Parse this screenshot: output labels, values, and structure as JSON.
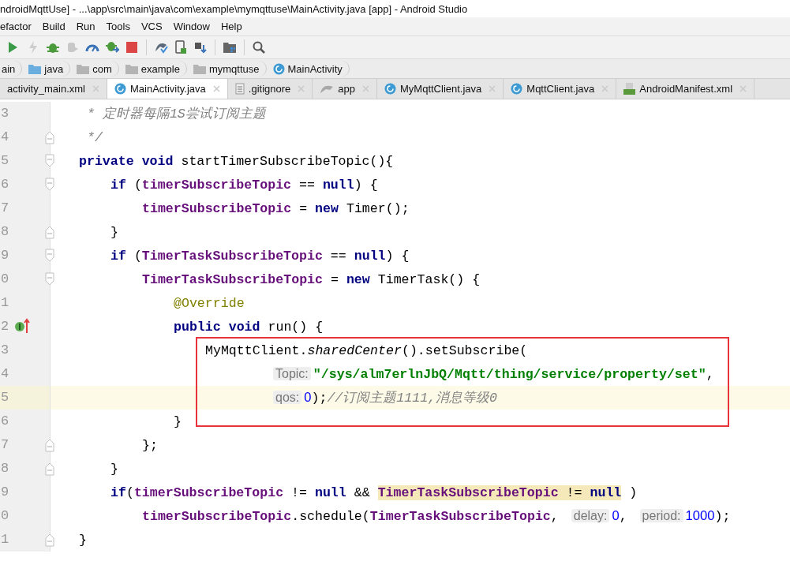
{
  "window": {
    "title": "ndroidMqttUse] - ...\\app\\src\\main\\java\\com\\example\\mymqttuse\\MainActivity.java [app] - Android Studio"
  },
  "menu": [
    "efactor",
    "Build",
    "Run",
    "Tools",
    "VCS",
    "Window",
    "Help"
  ],
  "toolbar": [
    {
      "kind": "run",
      "disabled": false
    },
    {
      "kind": "lightning",
      "disabled": true
    },
    {
      "kind": "debug",
      "disabled": false
    },
    {
      "kind": "attach",
      "disabled": true
    },
    {
      "kind": "profile",
      "disabled": false
    },
    {
      "kind": "apply",
      "disabled": false
    },
    {
      "kind": "stop",
      "disabled": false
    },
    {
      "kind": "sep"
    },
    {
      "kind": "sync",
      "disabled": false
    },
    {
      "kind": "avd",
      "disabled": false
    },
    {
      "kind": "sdk",
      "disabled": false
    },
    {
      "kind": "sep"
    },
    {
      "kind": "structure",
      "disabled": false
    },
    {
      "kind": "sep"
    },
    {
      "kind": "search",
      "disabled": false
    }
  ],
  "breadcrumbs": [
    {
      "label": "ain"
    },
    {
      "label": "java",
      "kind": "source-folder"
    },
    {
      "label": "com",
      "kind": "folder"
    },
    {
      "label": "example",
      "kind": "folder"
    },
    {
      "label": "mymqttuse",
      "kind": "folder"
    },
    {
      "label": "MainActivity",
      "kind": "class"
    }
  ],
  "tabs": [
    {
      "label": "activity_main.xml",
      "selected": false
    },
    {
      "label": "MainActivity.java",
      "kind": "class",
      "selected": true
    },
    {
      "label": ".gitignore",
      "kind": "file",
      "selected": false
    },
    {
      "label": "app",
      "kind": "module",
      "selected": false
    },
    {
      "label": "MyMqttClient.java",
      "kind": "class",
      "selected": false
    },
    {
      "label": "MqttClient.java",
      "kind": "class",
      "selected": false
    },
    {
      "label": "AndroidManifest.xml",
      "kind": "manifest",
      "selected": false
    }
  ],
  "editor": {
    "lines": [
      {
        "no": "3",
        "kind": "doc",
        "tokens": [
          {
            "kind": "comment",
            "t": "* 定时器每隔1S尝试订阅主题"
          }
        ]
      },
      {
        "no": "4",
        "kind": "doc",
        "fold_close": true,
        "tokens": [
          {
            "kind": "comment",
            "t": "*/"
          }
        ]
      },
      {
        "no": "5",
        "fold_open": true,
        "tokens": [
          {
            "kind": "kw",
            "t": "private void "
          },
          {
            "kind": "plain",
            "t": "startTimerSubscribeTopic(){"
          }
        ],
        "children": [
          {
            "no": "6",
            "fold_open": true,
            "tokens": [
              {
                "kind": "kw",
                "t": "if "
              },
              {
                "kind": "plain",
                "t": "("
              },
              {
                "kind": "field",
                "t": "timerSubscribeTopic"
              },
              {
                "kind": "plain",
                "t": " == "
              },
              {
                "kind": "kw",
                "t": "null"
              },
              {
                "kind": "plain",
                "t": ") {"
              }
            ],
            "children": [
              {
                "no": "7",
                "tokens": [
                  {
                    "kind": "field",
                    "t": "timerSubscribeTopic"
                  },
                  {
                    "kind": "plain",
                    "t": " = "
                  },
                  {
                    "kind": "kw",
                    "t": "new "
                  },
                  {
                    "kind": "plain",
                    "t": "Timer();"
                  }
                ]
              }
            ]
          },
          {
            "no": "8",
            "fold_close": true,
            "tokens": [
              {
                "kind": "plain",
                "t": "}"
              }
            ]
          },
          {
            "no": "9",
            "fold_open": true,
            "tokens": [
              {
                "kind": "kw",
                "t": "if "
              },
              {
                "kind": "plain",
                "t": "("
              },
              {
                "kind": "field",
                "t": "TimerTaskSubscribeTopic"
              },
              {
                "kind": "plain",
                "t": " == "
              },
              {
                "kind": "kw",
                "t": "null"
              },
              {
                "kind": "plain",
                "t": ") {"
              }
            ],
            "children": [
              {
                "no": "0",
                "fold_open": true,
                "tokens": [
                  {
                    "kind": "field",
                    "t": "TimerTaskSubscribeTopic"
                  },
                  {
                    "kind": "plain",
                    "t": " = "
                  },
                  {
                    "kind": "kw",
                    "t": "new "
                  },
                  {
                    "kind": "plain",
                    "t": "TimerTask() {"
                  }
                ],
                "children": [
                  {
                    "no": "1",
                    "tokens": [
                      {
                        "kind": "annot",
                        "t": "@Override"
                      }
                    ]
                  },
                  {
                    "no": "2",
                    "overrides": true,
                    "tokens": [
                      {
                        "kind": "kw",
                        "t": "public void "
                      },
                      {
                        "kind": "plain",
                        "t": "run() {"
                      }
                    ],
                    "children": [
                      {
                        "no": "3",
                        "boxed": true,
                        "kind": "call",
                        "tokens": [
                          {
                            "kind": "plain",
                            "t": "MyMqttClient."
                          },
                          {
                            "kind": "static",
                            "t": "sharedCenter"
                          },
                          {
                            "kind": "plain",
                            "t": "().setSubscribe("
                          }
                        ],
                        "children": [
                          {
                            "no": "4",
                            "boxed": true,
                            "tokens": [
                              {
                                "kind": "hint",
                                "t": "Topic:"
                              },
                              {
                                "kind": "string",
                                "t": "\"/sys/alm7erlnJbQ/Mqtt/thing/service/property/set\""
                              },
                              {
                                "kind": "plain",
                                "t": ","
                              }
                            ]
                          },
                          {
                            "no": "5",
                            "boxed": true,
                            "current": true,
                            "tokens": [
                              {
                                "kind": "hint",
                                "t": "qos:"
                              },
                              {
                                "kind": "num",
                                "t": "0"
                              },
                              {
                                "kind": "plain",
                                "t": ");"
                              },
                              {
                                "kind": "comment",
                                "t": "//订阅主题1111,消息等级0"
                              }
                            ]
                          }
                        ]
                      }
                    ]
                  },
                  {
                    "no": "6",
                    "tokens": [
                      {
                        "kind": "plain",
                        "t": "}"
                      }
                    ]
                  }
                ]
              },
              {
                "no": "7",
                "fold_close": true,
                "tokens": [
                  {
                    "kind": "plain",
                    "t": "};"
                  }
                ]
              }
            ]
          },
          {
            "no": "8",
            "fold_close": true,
            "tokens": [
              {
                "kind": "plain",
                "t": "}"
              }
            ]
          },
          {
            "no": "9",
            "tokens": [
              {
                "kind": "kw",
                "t": "if"
              },
              {
                "kind": "plain",
                "t": "("
              },
              {
                "kind": "field",
                "t": "timerSubscribeTopic"
              },
              {
                "kind": "plain",
                "t": " != "
              },
              {
                "kind": "kw",
                "t": "null"
              },
              {
                "kind": "plain",
                "t": " && "
              },
              {
                "kind": "field",
                "t": "TimerTaskSubscribeTopic",
                "match": true
              },
              {
                "kind": "plain",
                "t": " != ",
                "match": true
              },
              {
                "kind": "kw",
                "t": "null",
                "match": true
              },
              {
                "kind": "plain",
                "t": " )"
              }
            ],
            "children": [
              {
                "no": "0",
                "tokens": [
                  {
                    "kind": "field",
                    "t": "timerSubscribeTopic"
                  },
                  {
                    "kind": "plain",
                    "t": ".schedule("
                  },
                  {
                    "kind": "field",
                    "t": "TimerTaskSubscribeTopic"
                  },
                  {
                    "kind": "plain",
                    "t": ", "
                  },
                  {
                    "kind": "hint",
                    "t": "delay:"
                  },
                  {
                    "kind": "num",
                    "t": "0"
                  },
                  {
                    "kind": "plain",
                    "t": ", "
                  },
                  {
                    "kind": "hint",
                    "t": "period:"
                  },
                  {
                    "kind": "num",
                    "t": "1000"
                  },
                  {
                    "kind": "plain",
                    "t": ");"
                  }
                ]
              }
            ]
          }
        ]
      },
      {
        "no": "1",
        "fold_close": true,
        "tokens": [
          {
            "kind": "plain",
            "t": "}"
          }
        ]
      }
    ]
  }
}
